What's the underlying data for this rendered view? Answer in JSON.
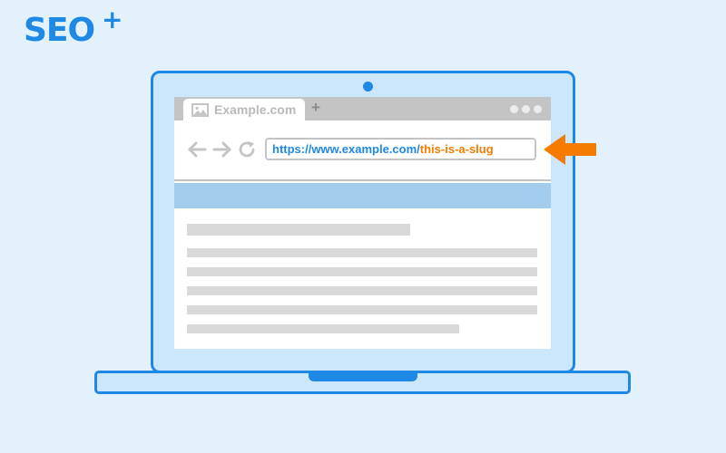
{
  "logo": {
    "text": "SEO",
    "plus": "+"
  },
  "browser": {
    "tab": {
      "title": "Example.com",
      "icon": "image-icon"
    },
    "new_tab_label": "+",
    "window_controls": [
      "dot",
      "dot",
      "dot"
    ],
    "nav": {
      "back_icon": "arrow-left-icon",
      "forward_icon": "arrow-right-icon",
      "reload_icon": "reload-icon"
    },
    "address": {
      "base": "https://www.example.com/",
      "slug": "this-is-a-slug"
    }
  },
  "page": {
    "banner_color": "#a3cdee",
    "content_lines": [
      "heading",
      "line",
      "line",
      "line",
      "line",
      "line"
    ]
  },
  "colors": {
    "brand": "#1e88e5",
    "slug": "#f57c00",
    "background": "#e3f1fc",
    "placeholder": "#d9d9d9"
  },
  "annotation": {
    "icon": "arrow-left-icon",
    "color": "#f57c00"
  }
}
